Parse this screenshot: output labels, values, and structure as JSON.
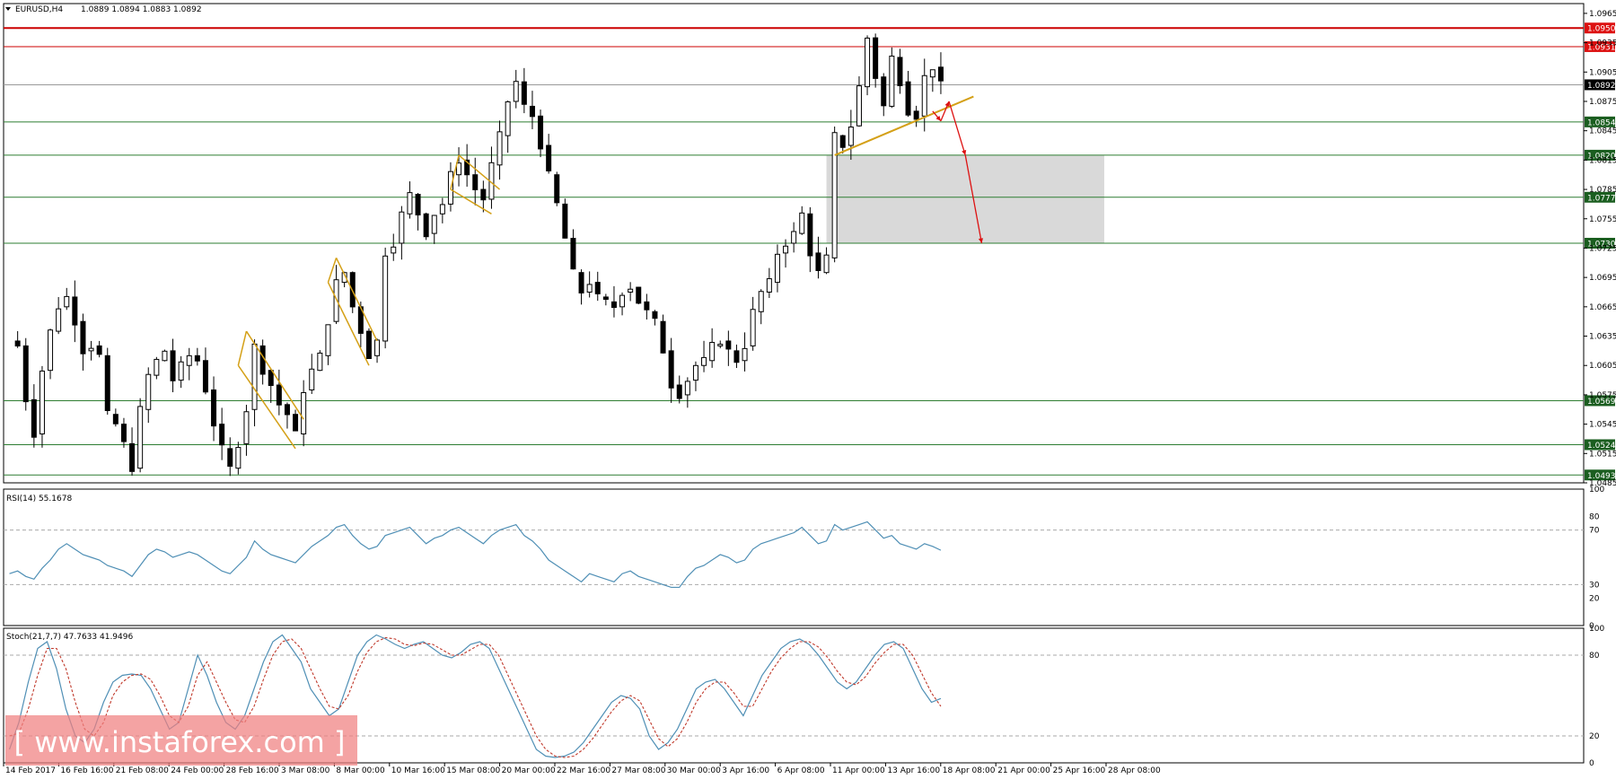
{
  "header": {
    "symbol": "EURUSD,H4",
    "ohlc": "1.0889 1.0894 1.0883 1.0892",
    "rsi_label": "RSI(14) 55.1678",
    "stoch_label": "Stoch(21,7,7) 47.7633 41.9496"
  },
  "watermark": {
    "text": "[ www.instaforex.com ]"
  },
  "colors": {
    "up_candle": "#ffffff",
    "down_candle": "#000000",
    "support_line": "#2e7d32",
    "resistance_line": "#cc0000",
    "trendline": "#d4a017",
    "forecast_arrow": "#dd1111",
    "indicator_line": "#4f8fb5",
    "signal_line": "#c0392b",
    "zone": "#d9d9d9",
    "watermark_bg": "#f08080"
  },
  "chart_data": [
    {
      "type": "candlestick",
      "symbol": "EURUSD",
      "timeframe": "H4",
      "ylim": [
        1.0485,
        1.0975
      ],
      "y_ticks": [
        "1.0965",
        "1.0935",
        "1.0905",
        "1.0875",
        "1.0845",
        "1.0815",
        "1.0785",
        "1.0755",
        "1.0725",
        "1.0695",
        "1.0665",
        "1.0635",
        "1.0605",
        "1.0575",
        "1.0545",
        "1.0515",
        "1.0485"
      ],
      "x_ticks": [
        "14 Feb 2017",
        "16 Feb 16:00",
        "21 Feb 08:00",
        "24 Feb 00:00",
        "28 Feb 16:00",
        "3 Mar 08:00",
        "8 Mar 00:00",
        "10 Mar 16:00",
        "15 Mar 08:00",
        "20 Mar 00:00",
        "22 Mar 16:00",
        "27 Mar 08:00",
        "30 Mar 00:00",
        "3 Apr 16:00",
        "6 Apr 08:00",
        "11 Apr 00:00",
        "13 Apr 16:00",
        "18 Apr 08:00",
        "21 Apr 00:00",
        "25 Apr 16:00",
        "28 Apr 08:00"
      ],
      "price_path": [
        [
          0,
          1.063
        ],
        [
          1,
          1.0625
        ],
        [
          2,
          1.057
        ],
        [
          3,
          1.0535
        ],
        [
          4,
          1.06
        ],
        [
          5,
          1.064
        ],
        [
          6,
          1.0665
        ],
        [
          7,
          1.0675
        ],
        [
          8,
          1.065
        ],
        [
          9,
          1.062
        ],
        [
          10,
          1.0625
        ],
        [
          11,
          1.0615
        ],
        [
          12,
          1.0555
        ],
        [
          13,
          1.0545
        ],
        [
          14,
          1.0525
        ],
        [
          15,
          1.05
        ],
        [
          16,
          1.056
        ],
        [
          17,
          1.0595
        ],
        [
          18,
          1.061
        ],
        [
          19,
          1.062
        ],
        [
          20,
          1.059
        ],
        [
          21,
          1.0605
        ],
        [
          22,
          1.0615
        ],
        [
          23,
          1.061
        ],
        [
          24,
          1.058
        ],
        [
          25,
          1.0545
        ],
        [
          26,
          1.052
        ],
        [
          27,
          1.05
        ],
        [
          28,
          1.0525
        ],
        [
          29,
          1.056
        ],
        [
          30,
          1.0625
        ],
        [
          31,
          1.06
        ],
        [
          32,
          1.0585
        ],
        [
          33,
          1.0565
        ],
        [
          34,
          1.0555
        ],
        [
          35,
          1.0535
        ],
        [
          36,
          1.058
        ],
        [
          37,
          1.06
        ],
        [
          38,
          1.0615
        ],
        [
          39,
          1.065
        ],
        [
          40,
          1.069
        ],
        [
          41,
          1.07
        ],
        [
          42,
          1.0665
        ],
        [
          43,
          1.064
        ],
        [
          44,
          1.0615
        ],
        [
          45,
          1.063
        ],
        [
          46,
          1.072
        ],
        [
          47,
          1.073
        ],
        [
          48,
          1.076
        ],
        [
          49,
          1.078
        ],
        [
          50,
          1.076
        ],
        [
          51,
          1.074
        ],
        [
          52,
          1.076
        ],
        [
          53,
          1.077
        ],
        [
          54,
          1.08
        ],
        [
          55,
          1.0815
        ],
        [
          56,
          1.08
        ],
        [
          57,
          1.0785
        ],
        [
          58,
          1.0775
        ],
        [
          59,
          1.081
        ],
        [
          60,
          1.084
        ],
        [
          61,
          1.0875
        ],
        [
          62,
          1.0895
        ],
        [
          63,
          1.087
        ],
        [
          64,
          1.086
        ],
        [
          65,
          1.083
        ],
        [
          66,
          1.08
        ],
        [
          67,
          1.077
        ],
        [
          68,
          1.0735
        ],
        [
          69,
          1.07
        ],
        [
          70,
          1.068
        ],
        [
          71,
          1.069
        ],
        [
          72,
          1.0675
        ],
        [
          73,
          1.067
        ],
        [
          74,
          1.0665
        ],
        [
          75,
          1.068
        ],
        [
          76,
          1.0685
        ],
        [
          77,
          1.067
        ],
        [
          78,
          1.066
        ],
        [
          79,
          1.065
        ],
        [
          80,
          1.062
        ],
        [
          81,
          1.0585
        ],
        [
          82,
          1.0575
        ],
        [
          83,
          1.059
        ],
        [
          84,
          1.0605
        ],
        [
          85,
          1.061
        ],
        [
          86,
          1.0625
        ],
        [
          87,
          1.063
        ],
        [
          88,
          1.062
        ],
        [
          89,
          1.061
        ],
        [
          90,
          1.0625
        ],
        [
          91,
          1.066
        ],
        [
          92,
          1.068
        ],
        [
          93,
          1.069
        ],
        [
          94,
          1.072
        ],
        [
          95,
          1.073
        ],
        [
          96,
          1.074
        ],
        [
          97,
          1.076
        ],
        [
          98,
          1.072
        ],
        [
          99,
          1.07
        ],
        [
          100,
          1.0715
        ],
        [
          101,
          1.084
        ],
        [
          102,
          1.083
        ],
        [
          103,
          1.085
        ],
        [
          104,
          1.089
        ],
        [
          105,
          1.094
        ],
        [
          106,
          1.09
        ],
        [
          107,
          1.087
        ],
        [
          108,
          1.092
        ],
        [
          109,
          1.0895
        ],
        [
          110,
          1.0865
        ],
        [
          111,
          1.086
        ],
        [
          112,
          1.09
        ],
        [
          113,
          1.091
        ],
        [
          114,
          1.0892
        ]
      ],
      "price_labels": [
        {
          "value": 1.095,
          "label": "1.0950",
          "kind": "resistance"
        },
        {
          "value": 1.0931,
          "label": "1.0931",
          "kind": "resistance"
        },
        {
          "value": 1.0892,
          "label": "1.0892",
          "kind": "current"
        },
        {
          "value": 1.0854,
          "label": "1.0854",
          "kind": "support"
        },
        {
          "value": 1.082,
          "label": "1.0820",
          "kind": "support"
        },
        {
          "value": 1.0777,
          "label": "1.0777",
          "kind": "support"
        },
        {
          "value": 1.073,
          "label": "1.0730",
          "kind": "support"
        },
        {
          "value": 1.0569,
          "label": "1.0569",
          "kind": "support"
        },
        {
          "value": 1.0524,
          "label": "1.0524",
          "kind": "support"
        },
        {
          "value": 1.0493,
          "label": "1.0493",
          "kind": "support"
        }
      ],
      "target_zone": {
        "from_bar": 100,
        "to_bar": 134,
        "high": 1.082,
        "low": 1.073
      },
      "flags": [
        {
          "a": [
            29,
            1.064
          ],
          "b": [
            36,
            1.055
          ],
          "c": [
            35,
            1.052
          ],
          "d": [
            28,
            1.0605
          ]
        },
        {
          "a": [
            40,
            1.0715
          ],
          "b": [
            45,
            1.063
          ],
          "c": [
            44,
            1.0605
          ],
          "d": [
            39,
            1.069
          ]
        },
        {
          "a": [
            55,
            1.082
          ],
          "b": [
            60,
            1.0785
          ],
          "c": [
            59,
            1.076
          ],
          "d": [
            54,
            1.0785
          ]
        }
      ],
      "trendline": {
        "from": [
          101,
          1.082
        ],
        "to": [
          118,
          1.088
        ]
      },
      "forecast_path": [
        [
          113,
          1.0865
        ],
        [
          114,
          1.0855
        ],
        [
          115,
          1.0875
        ],
        [
          117,
          1.082
        ],
        [
          119,
          1.073
        ]
      ],
      "grid": false
    },
    {
      "type": "line",
      "name": "RSI(14)",
      "ylim": [
        0,
        100
      ],
      "levels": [
        70,
        30
      ],
      "y_ticks": [
        "100",
        "80",
        "70",
        "30",
        "20",
        "0"
      ],
      "values": [
        38,
        40,
        36,
        34,
        42,
        48,
        56,
        60,
        56,
        52,
        50,
        48,
        44,
        42,
        40,
        36,
        44,
        52,
        56,
        54,
        50,
        52,
        54,
        52,
        48,
        44,
        40,
        38,
        44,
        50,
        62,
        56,
        52,
        50,
        48,
        46,
        52,
        58,
        62,
        66,
        72,
        74,
        66,
        60,
        56,
        58,
        66,
        68,
        70,
        72,
        66,
        60,
        64,
        66,
        70,
        72,
        68,
        64,
        60,
        66,
        70,
        72,
        74,
        66,
        62,
        56,
        48,
        44,
        40,
        36,
        32,
        38,
        36,
        34,
        32,
        38,
        40,
        36,
        34,
        32,
        30,
        28,
        28,
        36,
        42,
        44,
        48,
        52,
        50,
        46,
        48,
        56,
        60,
        62,
        64,
        66,
        68,
        72,
        66,
        60,
        62,
        74,
        70,
        72,
        74,
        76,
        70,
        64,
        66,
        60,
        58,
        56,
        60,
        58,
        55.17
      ]
    },
    {
      "type": "line",
      "name": "Stoch(21,7,7)",
      "ylim": [
        0,
        100
      ],
      "levels": [
        80,
        20
      ],
      "y_ticks": [
        "100",
        "80",
        "20",
        "0"
      ],
      "main": [
        10,
        30,
        60,
        85,
        90,
        70,
        40,
        20,
        15,
        25,
        45,
        60,
        65,
        66,
        65,
        55,
        40,
        25,
        30,
        55,
        80,
        65,
        45,
        30,
        25,
        35,
        55,
        75,
        90,
        95,
        85,
        75,
        55,
        45,
        35,
        40,
        60,
        80,
        90,
        95,
        92,
        88,
        85,
        88,
        90,
        85,
        80,
        78,
        82,
        88,
        90,
        85,
        70,
        55,
        40,
        25,
        10,
        5,
        4,
        5,
        8,
        15,
        25,
        35,
        45,
        50,
        48,
        40,
        20,
        10,
        15,
        25,
        40,
        55,
        60,
        62,
        55,
        45,
        35,
        50,
        65,
        75,
        85,
        90,
        92,
        88,
        80,
        70,
        60,
        55,
        60,
        70,
        80,
        88,
        90,
        85,
        70,
        55,
        45,
        47.76
      ],
      "signal": [
        20,
        22,
        40,
        65,
        85,
        85,
        70,
        45,
        25,
        20,
        30,
        50,
        60,
        65,
        66,
        62,
        50,
        35,
        30,
        42,
        65,
        75,
        60,
        45,
        32,
        30,
        42,
        62,
        80,
        90,
        92,
        85,
        70,
        55,
        42,
        40,
        50,
        68,
        82,
        90,
        93,
        92,
        88,
        87,
        89,
        88,
        84,
        80,
        80,
        84,
        88,
        88,
        80,
        65,
        50,
        35,
        20,
        10,
        5,
        4,
        5,
        10,
        18,
        28,
        38,
        46,
        50,
        46,
        32,
        18,
        12,
        18,
        30,
        45,
        55,
        60,
        60,
        52,
        42,
        42,
        55,
        68,
        78,
        85,
        90,
        90,
        86,
        78,
        68,
        60,
        58,
        64,
        74,
        82,
        88,
        88,
        80,
        66,
        52,
        41.95
      ]
    }
  ]
}
